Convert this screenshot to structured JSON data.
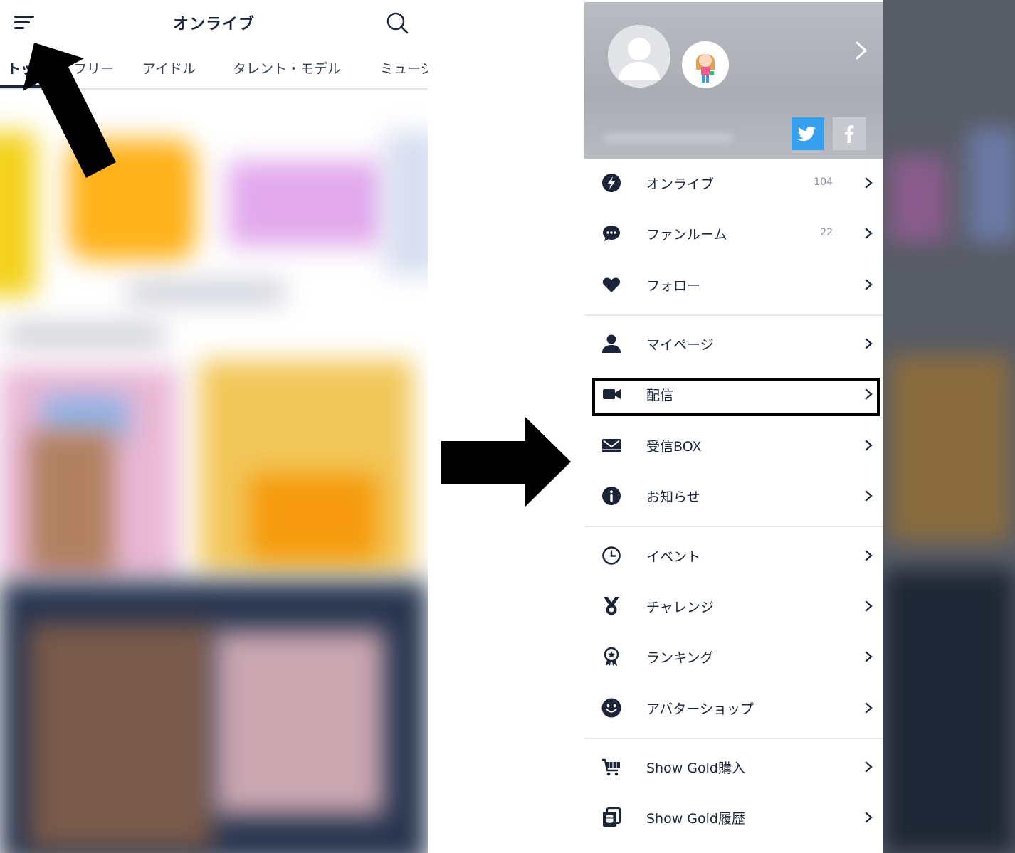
{
  "left": {
    "app_title": "オンライブ",
    "tabs": [
      {
        "label": "トップ",
        "active": true
      },
      {
        "label": "フリー"
      },
      {
        "label": "アイドル"
      },
      {
        "label": "タレント・モデル"
      },
      {
        "label": "ミュージシャン"
      }
    ],
    "icons": {
      "menu": "hamburger-menu-icon",
      "search": "search-icon"
    }
  },
  "drawer": {
    "profile": {
      "avatar": "default-avatar-icon",
      "character": "avatar-character-icon",
      "sns": [
        "twitter-icon",
        "facebook-icon"
      ]
    },
    "items": [
      {
        "label": "オンライブ",
        "count": "104",
        "icon": "lightning-icon"
      },
      {
        "label": "ファンルーム",
        "count": "22",
        "icon": "chat-bubble-icon"
      },
      {
        "label": "フォロー",
        "icon": "heart-icon"
      },
      {
        "label": "マイページ",
        "icon": "person-icon"
      },
      {
        "label": "配信",
        "icon": "video-camera-icon",
        "highlighted": true
      },
      {
        "label": "受信BOX",
        "icon": "mail-icon"
      },
      {
        "label": "お知らせ",
        "icon": "info-icon"
      },
      {
        "label": "イベント",
        "icon": "clock-icon"
      },
      {
        "label": "チャレンジ",
        "icon": "medal-icon"
      },
      {
        "label": "ランキング",
        "icon": "ranking-badge-icon"
      },
      {
        "label": "アバターショップ",
        "icon": "smiley-icon"
      },
      {
        "label": "Show Gold購入",
        "icon": "cart-icon"
      },
      {
        "label": "Show Gold履歴",
        "icon": "coin-history-icon"
      }
    ]
  },
  "colors": {
    "primary": "#1b2438",
    "twitter": "#37a1f0",
    "facebook_disabled": "#c8cacf",
    "highlight_border": "#000000"
  }
}
